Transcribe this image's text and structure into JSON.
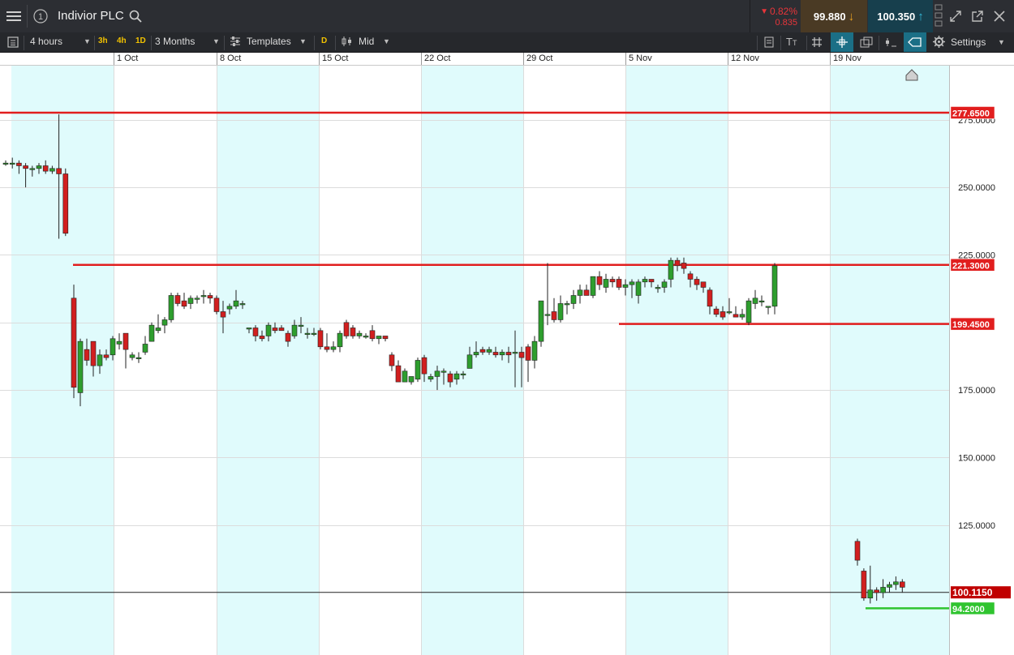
{
  "header": {
    "instrument": "Indivior PLC",
    "change_pct": "0.82%",
    "change_abs": "0.835",
    "sell_price": "99.880",
    "buy_price": "100.350",
    "colors": {
      "sell_bg": "#4a3a24",
      "buy_bg": "#173f4d",
      "down": "#e8353a",
      "sell_arrow": "#e8a020",
      "buy_arrow": "#33b7d6"
    }
  },
  "toolbar": {
    "interval": "4 hours",
    "quick_intervals": [
      "3h",
      "4h",
      "1D"
    ],
    "range": "3 Months",
    "templates_label": "Templates",
    "d_label": "D",
    "price_type": "Mid",
    "settings_label": "Settings"
  },
  "date_axis": {
    "labels": [
      "1 Oct",
      "8 Oct",
      "15 Oct",
      "22 Oct",
      "29 Oct",
      "5 Nov",
      "12 Nov",
      "19 Nov"
    ]
  },
  "chart_data": {
    "type": "candlestick",
    "y_ticks": [
      "275.0000",
      "250.0000",
      "225.0000",
      "175.0000",
      "150.0000",
      "125.0000"
    ],
    "ylim": [
      80,
      298
    ],
    "horizontal_lines": [
      {
        "label": "277.6500",
        "value": 277.65,
        "color": "#e11e1e"
      },
      {
        "label": "221.3000",
        "value": 221.3,
        "color": "#e11e1e"
      },
      {
        "label": "199.4500",
        "value": 199.45,
        "color": "#e11e1e"
      },
      {
        "label": "94.2000",
        "value": 94.2,
        "color": "#2fc42f"
      },
      {
        "label": "100.1150",
        "value": 100.115,
        "color": "#222222"
      }
    ],
    "current_price": "100.1150",
    "colors": {
      "up": "#2e9e2e",
      "down": "#d11f1f",
      "band": "#e0fbfc"
    },
    "candles": [
      [
        259,
        260,
        258,
        259
      ],
      [
        259,
        261,
        257,
        259
      ],
      [
        259,
        260,
        255,
        258
      ],
      [
        258,
        259,
        250,
        257
      ],
      [
        257,
        258,
        254,
        257
      ],
      [
        257,
        259,
        255,
        258
      ],
      [
        258,
        260,
        255,
        256
      ],
      [
        256,
        258,
        255,
        257
      ],
      [
        257,
        277,
        231,
        255
      ],
      [
        255,
        257,
        232,
        233
      ],
      [
        209,
        214,
        172,
        176
      ],
      [
        174,
        194,
        169,
        193
      ],
      [
        190,
        194,
        184,
        186
      ],
      [
        193,
        193,
        180,
        184
      ],
      [
        184,
        190,
        181,
        188
      ],
      [
        188,
        190,
        186,
        187
      ],
      [
        188,
        195,
        186,
        194
      ],
      [
        192,
        196,
        190,
        193
      ],
      [
        196,
        195,
        183,
        190
      ],
      [
        187,
        189,
        186,
        188
      ],
      [
        187,
        189,
        185,
        187
      ],
      [
        189,
        195,
        188,
        192
      ],
      [
        193,
        200,
        193,
        199
      ],
      [
        197,
        203,
        196,
        198
      ],
      [
        199,
        202,
        196,
        201
      ],
      [
        201,
        211,
        200,
        210
      ],
      [
        210,
        211,
        206,
        207
      ],
      [
        208,
        211,
        205,
        206
      ],
      [
        207,
        210,
        205,
        209
      ],
      [
        209,
        210,
        207,
        209
      ],
      [
        210,
        212,
        207,
        210
      ],
      [
        210,
        211,
        207,
        209
      ],
      [
        209,
        210,
        203,
        204
      ],
      [
        204,
        208,
        196,
        202
      ],
      [
        205,
        207,
        203,
        206
      ],
      [
        206,
        212,
        205,
        208
      ],
      [
        207,
        208,
        205,
        207
      ],
      [
        198,
        198,
        196,
        198
      ],
      [
        198,
        199,
        193,
        195
      ],
      [
        195,
        197,
        193,
        194
      ],
      [
        195,
        200,
        193,
        199
      ],
      [
        198,
        200,
        196,
        197
      ],
      [
        198,
        199,
        197,
        197
      ],
      [
        196,
        197,
        191,
        193
      ],
      [
        195,
        201,
        194,
        199
      ],
      [
        199,
        202,
        196,
        199
      ],
      [
        196,
        198,
        194,
        196
      ],
      [
        196,
        198,
        195,
        196
      ],
      [
        197,
        198,
        190,
        191
      ],
      [
        191,
        196,
        189,
        190
      ],
      [
        190,
        193,
        189,
        191
      ],
      [
        191,
        197,
        189,
        196
      ],
      [
        200,
        201,
        194,
        195
      ],
      [
        198,
        199,
        194,
        195
      ],
      [
        195,
        197,
        194,
        196
      ],
      [
        195,
        196,
        194,
        195
      ],
      [
        197,
        199,
        193,
        194
      ],
      [
        194,
        195,
        192,
        195
      ],
      [
        195,
        195,
        193,
        194
      ],
      [
        188,
        189,
        182,
        184
      ],
      [
        184,
        186,
        178,
        178
      ],
      [
        178,
        183,
        178,
        182
      ],
      [
        178,
        180,
        177,
        180
      ],
      [
        179,
        187,
        178,
        186
      ],
      [
        187,
        188,
        178,
        181
      ],
      [
        179,
        181,
        178,
        180
      ],
      [
        180,
        184,
        175,
        182
      ],
      [
        182,
        183,
        177,
        182
      ],
      [
        181,
        182,
        176,
        178
      ],
      [
        179,
        182,
        177,
        181
      ],
      [
        181,
        182,
        179,
        181
      ],
      [
        183,
        191,
        183,
        188
      ],
      [
        188,
        193,
        187,
        189
      ],
      [
        190,
        191,
        188,
        189
      ],
      [
        189,
        191,
        188,
        190
      ],
      [
        189,
        191,
        187,
        188
      ],
      [
        188,
        190,
        186,
        189
      ],
      [
        189,
        191,
        185,
        188
      ],
      [
        189,
        197,
        176,
        189
      ],
      [
        189,
        191,
        176,
        187
      ],
      [
        191,
        192,
        178,
        186
      ],
      [
        186,
        195,
        183,
        193
      ],
      [
        193,
        208,
        191,
        208
      ],
      [
        203,
        222,
        199,
        203
      ],
      [
        204,
        209,
        200,
        201
      ],
      [
        201,
        210,
        200,
        207
      ],
      [
        207,
        208,
        203,
        207
      ],
      [
        207,
        212,
        205,
        210
      ],
      [
        210,
        214,
        207,
        212
      ],
      [
        212,
        214,
        210,
        210
      ],
      [
        210,
        217,
        209,
        217
      ],
      [
        217,
        219,
        212,
        214
      ],
      [
        213,
        218,
        211,
        216
      ],
      [
        216,
        217,
        213,
        215
      ],
      [
        216,
        217,
        212,
        213
      ],
      [
        213,
        216,
        210,
        214
      ],
      [
        214,
        216,
        209,
        215
      ],
      [
        210,
        216,
        207,
        215
      ],
      [
        215,
        217,
        213,
        216
      ],
      [
        216,
        216,
        213,
        215
      ],
      [
        213,
        214,
        211,
        213
      ],
      [
        213,
        216,
        211,
        215
      ],
      [
        216,
        224,
        213,
        223
      ],
      [
        223,
        224,
        219,
        221
      ],
      [
        222,
        224,
        218,
        220
      ],
      [
        218,
        219,
        213,
        216
      ],
      [
        216,
        217,
        212,
        214
      ],
      [
        215,
        215,
        211,
        213
      ],
      [
        212,
        213,
        203,
        206
      ],
      [
        205,
        206,
        202,
        203
      ],
      [
        204,
        206,
        201,
        202
      ],
      [
        204,
        209,
        203,
        204
      ],
      [
        203,
        206,
        202,
        202
      ],
      [
        202,
        205,
        201,
        203
      ],
      [
        200,
        209,
        199,
        208
      ],
      [
        207,
        212,
        205,
        209
      ],
      [
        208,
        210,
        206,
        208
      ],
      [
        206,
        206,
        203,
        206
      ],
      [
        206,
        222,
        203,
        221
      ],
      [
        119,
        120,
        110,
        112
      ],
      [
        108,
        109,
        97,
        98
      ],
      [
        98,
        110,
        96,
        101
      ],
      [
        101,
        102,
        97,
        100
      ],
      [
        100,
        105,
        98,
        102
      ],
      [
        102,
        104,
        100,
        103
      ],
      [
        103,
        106,
        101,
        104
      ],
      [
        104,
        105,
        100,
        102
      ]
    ]
  }
}
